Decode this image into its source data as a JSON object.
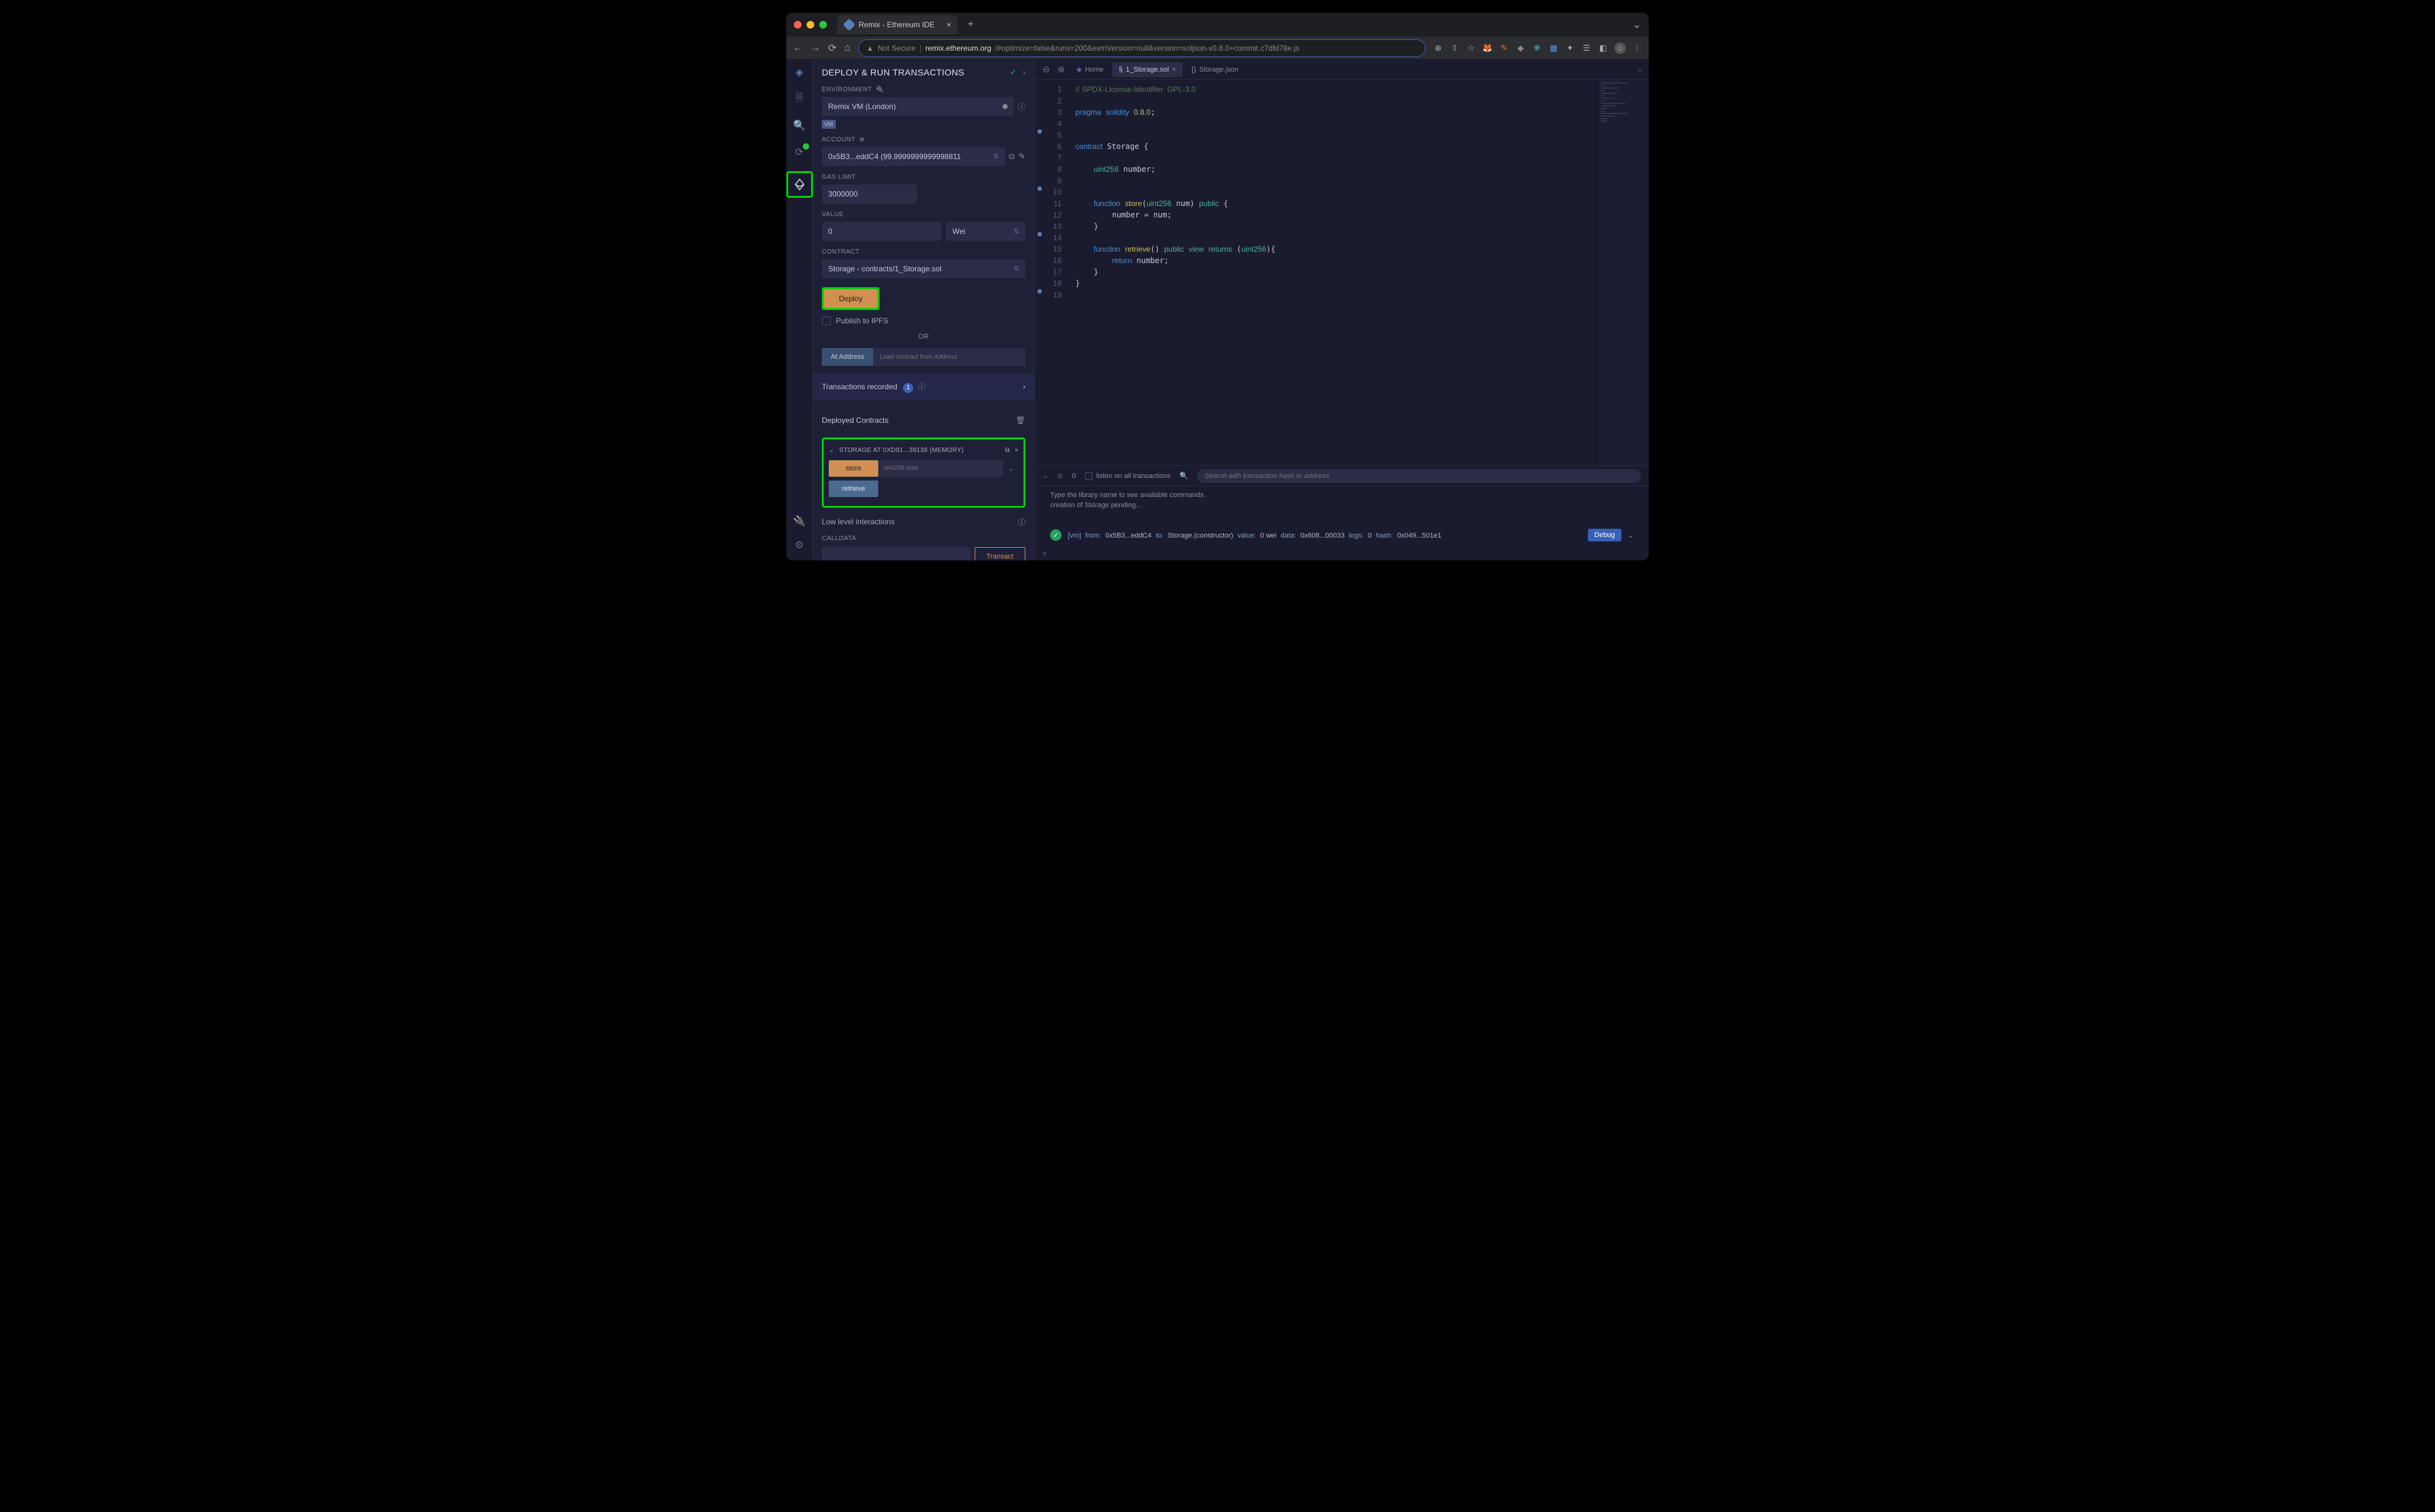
{
  "browser": {
    "tab_title": "Remix - Ethereum IDE",
    "url_secure_label": "Not Secure",
    "url_domain": "remix.ethereum.org",
    "url_path": "/#optimize=false&runs=200&evmVersion=null&version=soljson-v0.8.0+commit.c7dfd78e.js"
  },
  "sidepanel": {
    "title": "DEPLOY & RUN TRANSACTIONS",
    "env_label": "ENVIRONMENT",
    "env_value": "Remix VM (London)",
    "vm_badge": "VM",
    "account_label": "ACCOUNT",
    "account_value": "0x5B3...eddC4 (99.9999999999998811",
    "gas_label": "GAS LIMIT",
    "gas_value": "3000000",
    "value_label": "VALUE",
    "value_amount": "0",
    "value_unit": "Wei",
    "contract_label": "CONTRACT",
    "contract_value": "Storage - contracts/1_Storage.sol",
    "deploy_btn": "Deploy",
    "publish_ipfs": "Publish to IPFS",
    "or_label": "OR",
    "at_address_btn": "At Address",
    "at_address_placeholder": "Load contract from Address",
    "tx_recorded": "Transactions recorded",
    "tx_recorded_count": "1",
    "deployed_title": "Deployed Contracts",
    "deployed_instance": "STORAGE AT 0XD91...39138 (MEMORY)",
    "fn_store": "store",
    "fn_store_placeholder": "uint256 num",
    "fn_retrieve": "retrieve",
    "lowlevel_title": "Low level interactions",
    "calldata_label": "CALLDATA",
    "transact_btn": "Transact"
  },
  "editor": {
    "tab_home": "Home",
    "tab_storage": "1_Storage.sol",
    "tab_json": "Storage.json",
    "code_lines": [
      "// SPDX-License-Identifier: GPL-3.0",
      "",
      "pragma solidity 0.8.0;",
      "",
      "",
      "contract Storage {",
      "",
      "    uint256 number;",
      "",
      "",
      "    function store(uint256 num) public {",
      "        number = num;",
      "    }",
      "",
      "    function retrieve() public view returns (uint256){",
      "        return number;",
      "    }",
      "}",
      ""
    ]
  },
  "terminal": {
    "pending_count": "0",
    "listen_label": "listen on all transactions",
    "search_placeholder": "Search with transaction hash or address",
    "line1": "Type the library name to see available commands.",
    "line2": "creation of Storage pending...",
    "tx_vm": "[vm]",
    "tx_from_k": "from:",
    "tx_from_v": "0x5B3...eddC4",
    "tx_to_k": "to:",
    "tx_to_v": "Storage.(constructor)",
    "tx_value_k": "value:",
    "tx_value_v": "0 wei",
    "tx_data_k": "data:",
    "tx_data_v": "0x608...00033",
    "tx_logs_k": "logs:",
    "tx_logs_v": "0",
    "tx_hash_k": "hash:",
    "tx_hash_v": "0x049...501e1",
    "debug_btn": "Debug",
    "prompt": ">"
  }
}
